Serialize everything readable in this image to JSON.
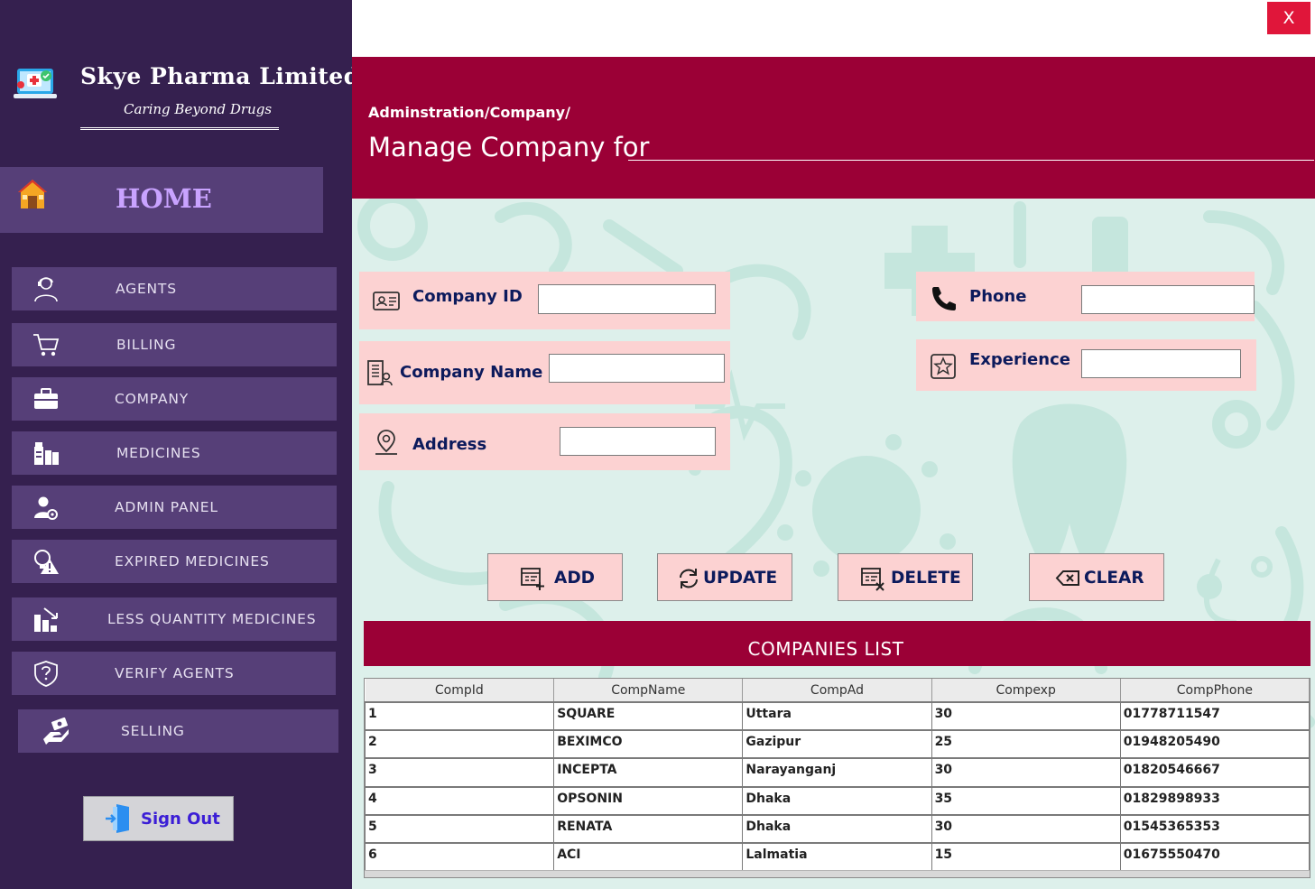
{
  "brand": {
    "title": "Skye Pharma Limited",
    "tagline": "Caring Beyond Drugs"
  },
  "sidebar": {
    "home_label": "HOME",
    "items": [
      {
        "label": "AGENTS",
        "icon": "agent-icon"
      },
      {
        "label": "BILLING",
        "icon": "cart-icon"
      },
      {
        "label": "COMPANY",
        "icon": "briefcase-icon"
      },
      {
        "label": "MEDICINES",
        "icon": "medicine-bottles-icon"
      },
      {
        "label": "ADMIN PANEL",
        "icon": "user-gear-icon"
      },
      {
        "label": "EXPIRED MEDICINES",
        "icon": "warning-bulb-icon"
      },
      {
        "label": "LESS QUANTITY MEDICINES",
        "icon": "bar-decrease-icon"
      },
      {
        "label": "VERIFY AGENTS",
        "icon": "shield-question-icon"
      },
      {
        "label": "SELLING",
        "icon": "hand-coin-icon"
      }
    ],
    "signout_label": "Sign Out"
  },
  "window": {
    "close_label": "X"
  },
  "header": {
    "breadcrumb": "Adminstration/Company/",
    "title": "Manage Company for"
  },
  "form": {
    "company_id": {
      "label": "Company ID",
      "value": ""
    },
    "company_name": {
      "label": "Company Name",
      "value": ""
    },
    "address": {
      "label": "Address",
      "value": ""
    },
    "phone": {
      "label": "Phone",
      "value": ""
    },
    "experience": {
      "label": "Experience",
      "value": ""
    }
  },
  "actions": {
    "add": "ADD",
    "update": "UPDATE",
    "delete": "DELETE",
    "clear": "CLEAR"
  },
  "companies": {
    "title": "COMPANIES LIST",
    "columns": [
      "CompId",
      "CompName",
      "CompAd",
      "Compexp",
      "CompPhone"
    ],
    "rows": [
      [
        "1",
        "SQUARE",
        "Uttara",
        "30",
        "01778711547"
      ],
      [
        "2",
        "BEXIMCO",
        "Gazipur",
        "25",
        "01948205490"
      ],
      [
        "3",
        "INCEPTA",
        "Narayanganj",
        "30",
        "01820546667"
      ],
      [
        "4",
        "OPSONIN",
        "Dhaka",
        "35",
        "01829898933"
      ],
      [
        "5",
        "RENATA",
        "Dhaka",
        "30",
        "01545365353"
      ],
      [
        "6",
        "ACI",
        "Lalmatia",
        "15",
        "01675550470"
      ]
    ]
  },
  "colors": {
    "sidebar_bg": "#35204f",
    "nav_item_bg": "#563f78",
    "header_bg": "#9b0036",
    "panel_bg": "#fcd2d2",
    "label_text": "#0c1a5c",
    "close_bg": "#e0163a",
    "content_bg": "#ddf0eb"
  }
}
